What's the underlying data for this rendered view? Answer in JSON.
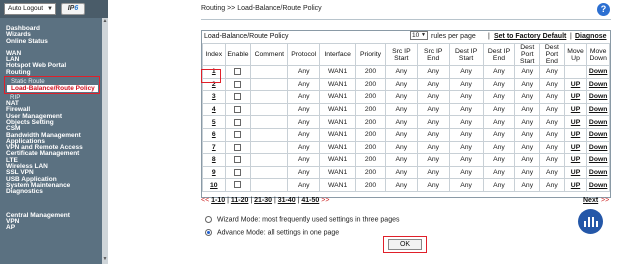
{
  "sidebar": {
    "logout_label": "Auto Logout",
    "ipv6_prefix": "IP",
    "ipv6_suffix": "6",
    "items": [
      {
        "label": "Dashboard",
        "type": "main"
      },
      {
        "label": "Wizards",
        "type": "main"
      },
      {
        "label": "Online Status",
        "type": "main"
      },
      {
        "label": "",
        "type": "gap"
      },
      {
        "label": "WAN",
        "type": "main"
      },
      {
        "label": "LAN",
        "type": "main"
      },
      {
        "label": "Hotspot Web Portal",
        "type": "main"
      },
      {
        "label": "Routing",
        "type": "main"
      }
    ],
    "routing_subitems": {
      "static_route": "Static Route",
      "load_balance": "Load-Balance/Route Policy",
      "rip": "RIP"
    },
    "items_after": [
      "NAT",
      "Firewall",
      "User Management",
      "Objects Setting",
      "CSM",
      "Bandwidth Management",
      "Applications",
      "VPN and Remote Access",
      "Certificate Management",
      "LTE",
      "Wireless LAN",
      "SSL VPN",
      "USB Application",
      "System Maintenance",
      "Diagnostics"
    ],
    "items_bottom": [
      "Central Management",
      "VPN",
      "AP"
    ]
  },
  "main": {
    "breadcrumb": "Routing >> Load-Balance/Route Policy",
    "help_glyph": "?",
    "panel_title": "Load-Balance/Route Policy",
    "rows_select": "10",
    "rows_per_page_label": "rules per page",
    "set_factory_default": "Set to Factory Default",
    "diagnose": "Diagnose",
    "columns": [
      "Index",
      "Enable",
      "Comment",
      "Protocol",
      "Interface",
      "Priority",
      "Src IP Start",
      "Src IP End",
      "Dest IP Start",
      "Dest IP End",
      "Dest Port Start",
      "Dest Port End",
      "Move Up",
      "Move Down"
    ],
    "rows": [
      {
        "index": "1",
        "protocol": "Any",
        "interface": "WAN1",
        "priority": "200",
        "src_start": "Any",
        "src_end": "Any",
        "dst_start": "Any",
        "dst_end": "Any",
        "port_start": "Any",
        "port_end": "Any",
        "up": "",
        "down": "Down"
      },
      {
        "index": "2",
        "protocol": "Any",
        "interface": "WAN1",
        "priority": "200",
        "src_start": "Any",
        "src_end": "Any",
        "dst_start": "Any",
        "dst_end": "Any",
        "port_start": "Any",
        "port_end": "Any",
        "up": "UP",
        "down": "Down"
      },
      {
        "index": "3",
        "protocol": "Any",
        "interface": "WAN1",
        "priority": "200",
        "src_start": "Any",
        "src_end": "Any",
        "dst_start": "Any",
        "dst_end": "Any",
        "port_start": "Any",
        "port_end": "Any",
        "up": "UP",
        "down": "Down"
      },
      {
        "index": "4",
        "protocol": "Any",
        "interface": "WAN1",
        "priority": "200",
        "src_start": "Any",
        "src_end": "Any",
        "dst_start": "Any",
        "dst_end": "Any",
        "port_start": "Any",
        "port_end": "Any",
        "up": "UP",
        "down": "Down"
      },
      {
        "index": "5",
        "protocol": "Any",
        "interface": "WAN1",
        "priority": "200",
        "src_start": "Any",
        "src_end": "Any",
        "dst_start": "Any",
        "dst_end": "Any",
        "port_start": "Any",
        "port_end": "Any",
        "up": "UP",
        "down": "Down"
      },
      {
        "index": "6",
        "protocol": "Any",
        "interface": "WAN1",
        "priority": "200",
        "src_start": "Any",
        "src_end": "Any",
        "dst_start": "Any",
        "dst_end": "Any",
        "port_start": "Any",
        "port_end": "Any",
        "up": "UP",
        "down": "Down"
      },
      {
        "index": "7",
        "protocol": "Any",
        "interface": "WAN1",
        "priority": "200",
        "src_start": "Any",
        "src_end": "Any",
        "dst_start": "Any",
        "dst_end": "Any",
        "port_start": "Any",
        "port_end": "Any",
        "up": "UP",
        "down": "Down"
      },
      {
        "index": "8",
        "protocol": "Any",
        "interface": "WAN1",
        "priority": "200",
        "src_start": "Any",
        "src_end": "Any",
        "dst_start": "Any",
        "dst_end": "Any",
        "port_start": "Any",
        "port_end": "Any",
        "up": "UP",
        "down": "Down"
      },
      {
        "index": "9",
        "protocol": "Any",
        "interface": "WAN1",
        "priority": "200",
        "src_start": "Any",
        "src_end": "Any",
        "dst_start": "Any",
        "dst_end": "Any",
        "port_start": "Any",
        "port_end": "Any",
        "up": "UP",
        "down": "Down"
      },
      {
        "index": "10",
        "protocol": "Any",
        "interface": "WAN1",
        "priority": "200",
        "src_start": "Any",
        "src_end": "Any",
        "dst_start": "Any",
        "dst_end": "Any",
        "port_start": "Any",
        "port_end": "Any",
        "up": "UP",
        "down": "Down"
      }
    ],
    "pager": {
      "prev": "<<",
      "pages": [
        "1-10",
        "11-20",
        "21-30",
        "31-40",
        "41-50"
      ],
      "next_arrows": ">>",
      "next_label": "Next"
    },
    "wizard_mode": "Wizard Mode: most frequently used settings in three pages",
    "advance_mode": "Advance Mode: all settings in one page",
    "ok_label": "OK"
  },
  "colors": {
    "sidebar_bg": "#5b7181",
    "highlight_red": "#e0202a",
    "accent_blue": "#2c6fd1"
  }
}
